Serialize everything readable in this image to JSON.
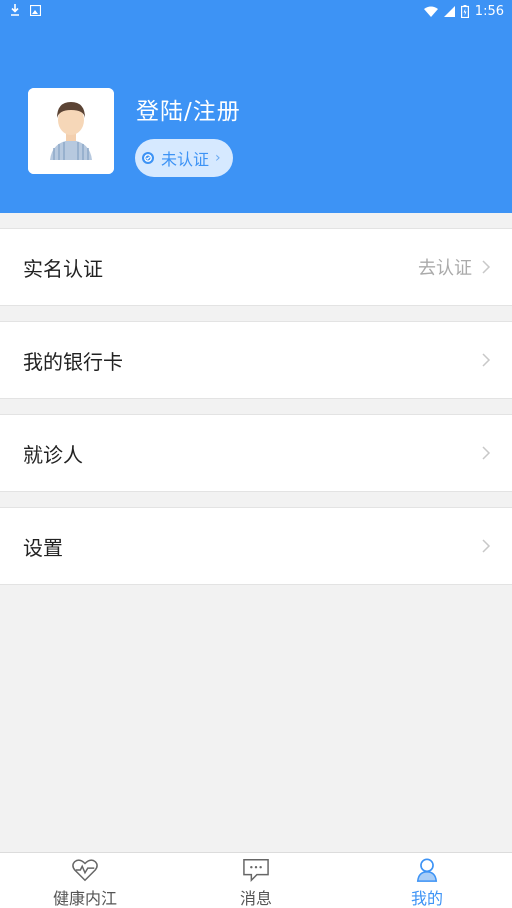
{
  "status_bar": {
    "time": "1:56"
  },
  "profile": {
    "login_label": "登陆/注册",
    "verify_status": "未认证"
  },
  "menu": [
    {
      "label": "实名认证",
      "hint": "去认证"
    },
    {
      "label": "我的银行卡",
      "hint": ""
    },
    {
      "label": "就诊人",
      "hint": ""
    },
    {
      "label": "设置",
      "hint": ""
    }
  ],
  "tabs": [
    {
      "label": "健康内江",
      "icon": "heart-pulse-icon",
      "active": false
    },
    {
      "label": "消息",
      "icon": "message-icon",
      "active": false
    },
    {
      "label": "我的",
      "icon": "person-icon",
      "active": true
    }
  ],
  "colors": {
    "primary": "#3d93f5",
    "background": "#f2f2f2"
  }
}
